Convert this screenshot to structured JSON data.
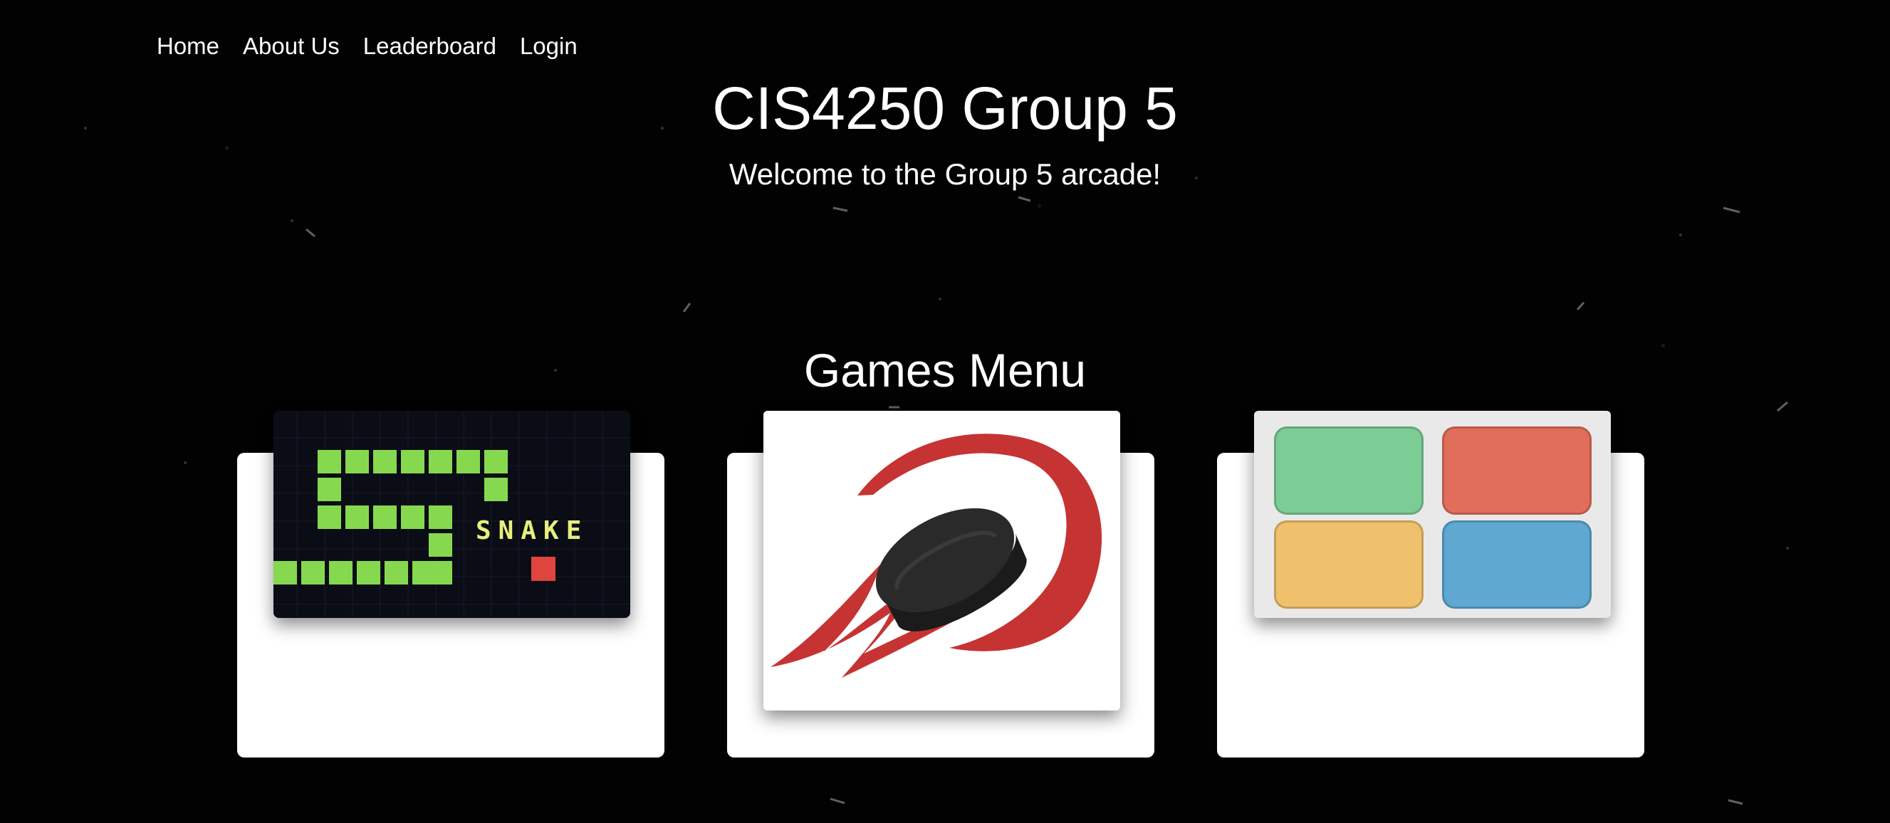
{
  "nav": {
    "items": [
      "Home",
      "About Us",
      "Leaderboard",
      "Login"
    ]
  },
  "header": {
    "title": "CIS4250 Group 5",
    "subtitle": "Welcome to the Group 5 arcade!"
  },
  "games": {
    "title": "Games Menu",
    "cards": [
      {
        "name": "snake",
        "thumbnail_text": "SNAKE",
        "icon": "snake-game-thumbnail"
      },
      {
        "name": "hockey",
        "icon": "hockey-puck-logo"
      },
      {
        "name": "simon",
        "icon": "simon-color-pads"
      }
    ]
  },
  "colors": {
    "background": "#000000",
    "text": "#ffffff",
    "card": "#ffffff",
    "snake_green": "#86d94f",
    "snake_food": "#e0443e",
    "snake_text": "#e7ef7c",
    "simon_green": "#7ccc96",
    "simon_red": "#e16e5a",
    "simon_yellow": "#f0c16c",
    "simon_blue": "#5ea8d1",
    "hockey_red": "#c63333"
  }
}
